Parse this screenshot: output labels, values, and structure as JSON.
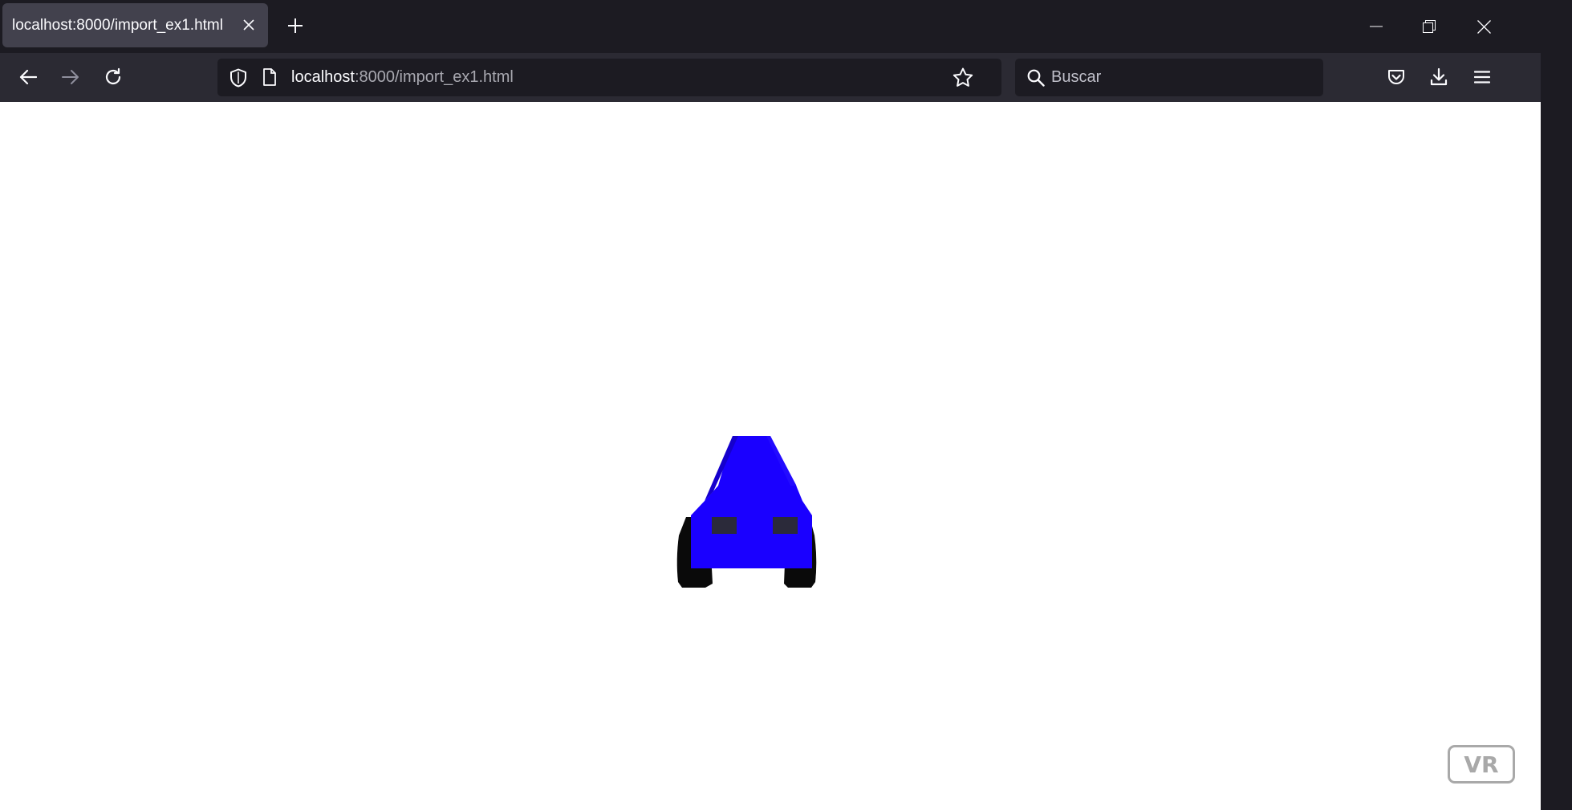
{
  "browser": {
    "tab": {
      "title": "localhost:8000/import_ex1.html"
    },
    "url": {
      "host": "localhost",
      "rest": ":8000/import_ex1.html"
    },
    "search": {
      "placeholder": "Buscar"
    }
  },
  "page": {
    "vr_button_label": "VR",
    "car_color": "#1a00ff"
  },
  "icons": [
    "close-icon",
    "plus-icon",
    "minimize-icon",
    "restore-icon",
    "back-icon",
    "forward-icon",
    "reload-icon",
    "shield-icon",
    "page-icon",
    "star-icon",
    "search-icon",
    "pocket-icon",
    "download-icon",
    "menu-icon"
  ]
}
